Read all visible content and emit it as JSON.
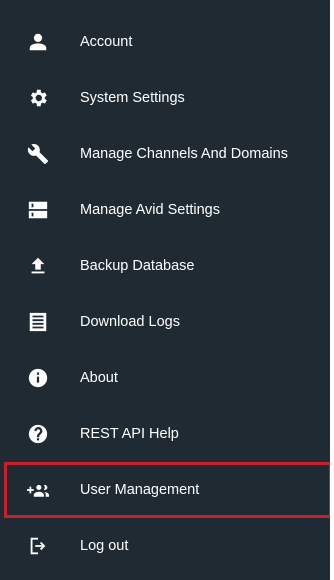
{
  "menu": {
    "items": [
      {
        "label": "Account",
        "icon": "person-icon"
      },
      {
        "label": "System Settings",
        "icon": "gear-icon"
      },
      {
        "label": "Manage Channels And Domains",
        "icon": "wrench-icon"
      },
      {
        "label": "Manage Avid Settings",
        "icon": "server-icon"
      },
      {
        "label": "Backup Database",
        "icon": "upload-icon"
      },
      {
        "label": "Download Logs",
        "icon": "document-list-icon"
      },
      {
        "label": "About",
        "icon": "info-icon"
      },
      {
        "label": "REST API Help",
        "icon": "help-icon"
      },
      {
        "label": "User Management",
        "icon": "add-group-icon"
      },
      {
        "label": "Log out",
        "icon": "logout-icon"
      }
    ]
  },
  "colors": {
    "panel_background": "#1f2a32",
    "text": "#ffffff",
    "highlight_border": "#c8202a"
  }
}
